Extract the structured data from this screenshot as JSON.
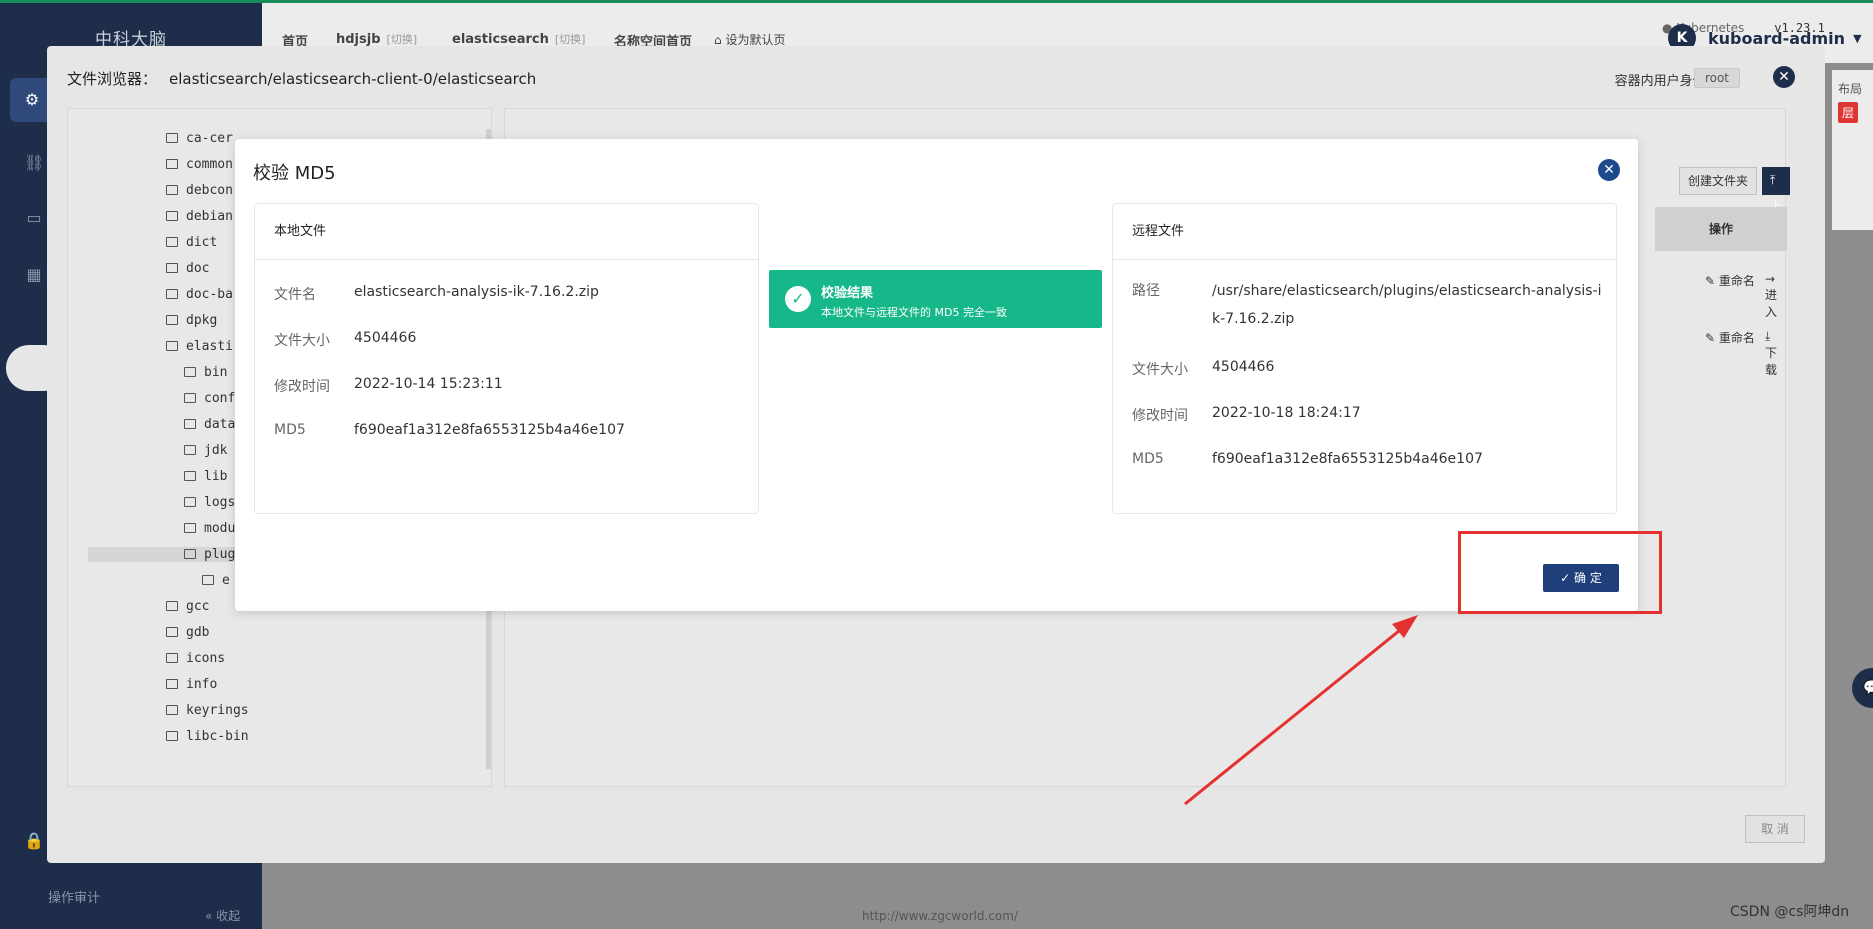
{
  "app": {
    "brand": "中科大脑",
    "sidebar_bottom_label": "操作审计",
    "sidebar_collapse": "« 收起"
  },
  "header": {
    "crumbs": [
      {
        "label": "首页",
        "sub": ""
      },
      {
        "label": "hdjsjb",
        "sub": "[切换]"
      },
      {
        "label": "elasticsearch",
        "sub": "[切换]"
      },
      {
        "label": "名称空间首页",
        "sub": ""
      }
    ],
    "set_default": "设为默认页",
    "k8s_label": "Kubernetes",
    "k8s_version": "v1.23.1",
    "user": {
      "initial": "K",
      "name": "kuboard-admin"
    }
  },
  "right_edge": {
    "layout": "布局",
    "tag": "层"
  },
  "file_browser": {
    "title_label": "文件浏览器：",
    "path": "elasticsearch/elasticsearch-client-0/elasticsearch",
    "user_label": "容器内用户身份:",
    "user_value": "root",
    "cancel": "取 消",
    "create_folder": "创建文件夹",
    "upload": "上 传",
    "ops_header": "操作",
    "row_actions": [
      {
        "rename": "重命名",
        "other": "进 入"
      },
      {
        "rename": "重命名",
        "other": "下 载"
      }
    ],
    "tree": [
      "ca-cer",
      "common",
      "debcon",
      "debian",
      "dict",
      "doc",
      "doc-ba",
      "dpkg",
      "elasti",
      "bin",
      "conf",
      "data",
      "jdk",
      "lib",
      "logs",
      "modu",
      "plug",
      "e",
      "gcc",
      "gdb",
      "icons",
      "info",
      "keyrings",
      "libc-bin"
    ]
  },
  "modal": {
    "title": "校验 MD5",
    "local": {
      "header": "本地文件",
      "rows": [
        {
          "label": "文件名",
          "value": "elasticsearch-analysis-ik-7.16.2.zip"
        },
        {
          "label": "文件大小",
          "value": "4504466"
        },
        {
          "label": "修改时间",
          "value": "2022-10-14 15:23:11"
        },
        {
          "label": "MD5",
          "value": "f690eaf1a312e8fa6553125b4a46e107"
        }
      ]
    },
    "remote": {
      "header": "远程文件",
      "rows": [
        {
          "label": "路径",
          "value": "/usr/share/elasticsearch/plugins/elasticsearch-analysis-ik-7.16.2.zip"
        },
        {
          "label": "文件大小",
          "value": "4504466"
        },
        {
          "label": "修改时间",
          "value": "2022-10-18 18:24:17"
        },
        {
          "label": "MD5",
          "value": "f690eaf1a312e8fa6553125b4a46e107"
        }
      ]
    },
    "result": {
      "title": "校验结果",
      "description": "本地文件与远程文件的 MD5 完全一致"
    },
    "confirm": "确 定"
  },
  "footer": {
    "url": "http://www.zgcworld.com/",
    "watermark": "CSDN @cs阿坤dn"
  }
}
